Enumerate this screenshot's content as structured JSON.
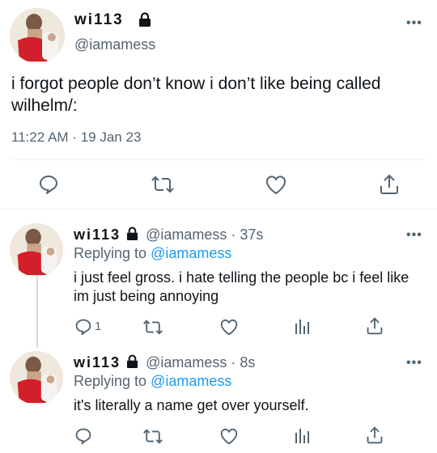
{
  "main_tweet": {
    "display_name": "wi113",
    "handle": "@iamamess",
    "text": "i forgot people don’t know i don’t like being called wilhelm/:",
    "time": "11:22 AM",
    "date": "19 Jan 23",
    "time_separator": "·"
  },
  "replies": [
    {
      "display_name": "wi113",
      "handle": "@iamamess",
      "age": "· 37s",
      "replying_prefix": "Replying to",
      "replying_to": "@iamamess",
      "text": "i just feel gross. i hate telling the people bc i feel like im just being annoying",
      "reply_count": "1"
    },
    {
      "display_name": "wi113",
      "handle": "@iamamess",
      "age": "· 8s",
      "replying_prefix": "Replying to",
      "replying_to": "@iamamess",
      "text": "it's literally a name get over yourself.",
      "reply_count": ""
    }
  ],
  "more_label": "•••",
  "colors": {
    "accent": "#1d9bf0",
    "muted": "#536471",
    "text": "#0f1419",
    "divider": "#eff3f4"
  },
  "icons": [
    "lock-icon",
    "more-icon",
    "reply-icon",
    "retweet-icon",
    "like-icon",
    "share-icon",
    "analytics-icon"
  ]
}
